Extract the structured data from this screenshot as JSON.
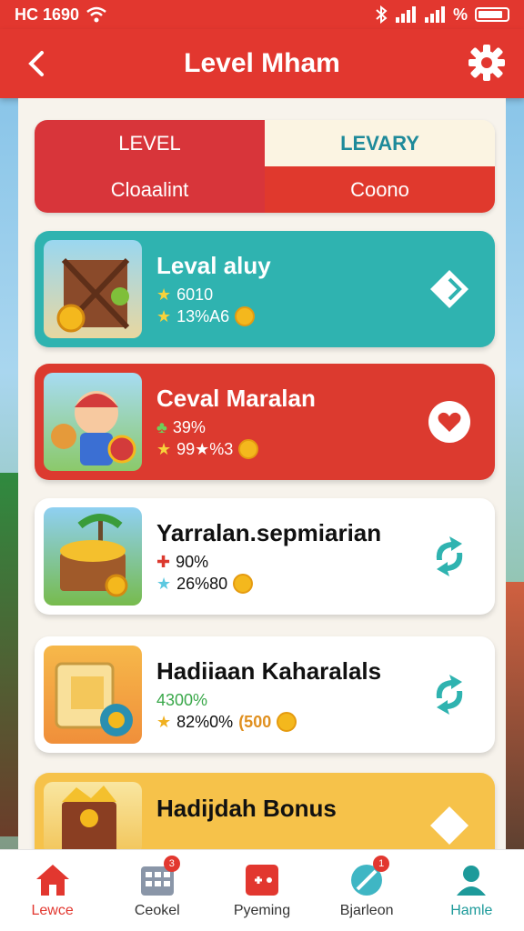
{
  "status_bar": {
    "time": "HC 1690",
    "battery": "%"
  },
  "app_bar": {
    "title": "Level Mham"
  },
  "tabs": [
    {
      "label": "LEVEL"
    },
    {
      "label": "LEVARY"
    },
    {
      "label": "Cloaalint"
    },
    {
      "label": "Coono"
    }
  ],
  "cards": [
    {
      "name": "Leval aluy",
      "stat1": "6010",
      "stat2": "13%A6"
    },
    {
      "name": "Ceval Maralan",
      "stat1": "39%",
      "stat2": "99★%3"
    },
    {
      "name": "Yarralan.sepmiarian",
      "stat1": "90%",
      "stat2": "26%80"
    },
    {
      "name": "Hadiiaan Kaharalals",
      "stat1": "4300%",
      "stat2": "82%0%",
      "extra": "(500"
    },
    {
      "name": "Hadijdah Bonus"
    }
  ],
  "bottom_nav": [
    {
      "label": "Lewce",
      "badge": ""
    },
    {
      "label": "Ceokel",
      "badge": "3"
    },
    {
      "label": "Pyeming",
      "badge": ""
    },
    {
      "label": "Bjarleon",
      "badge": "1"
    },
    {
      "label": "Hamle",
      "badge": ""
    }
  ],
  "colors": {
    "primary": "#e2372f",
    "teal": "#2fb3b0",
    "yellow": "#f6c24a"
  }
}
